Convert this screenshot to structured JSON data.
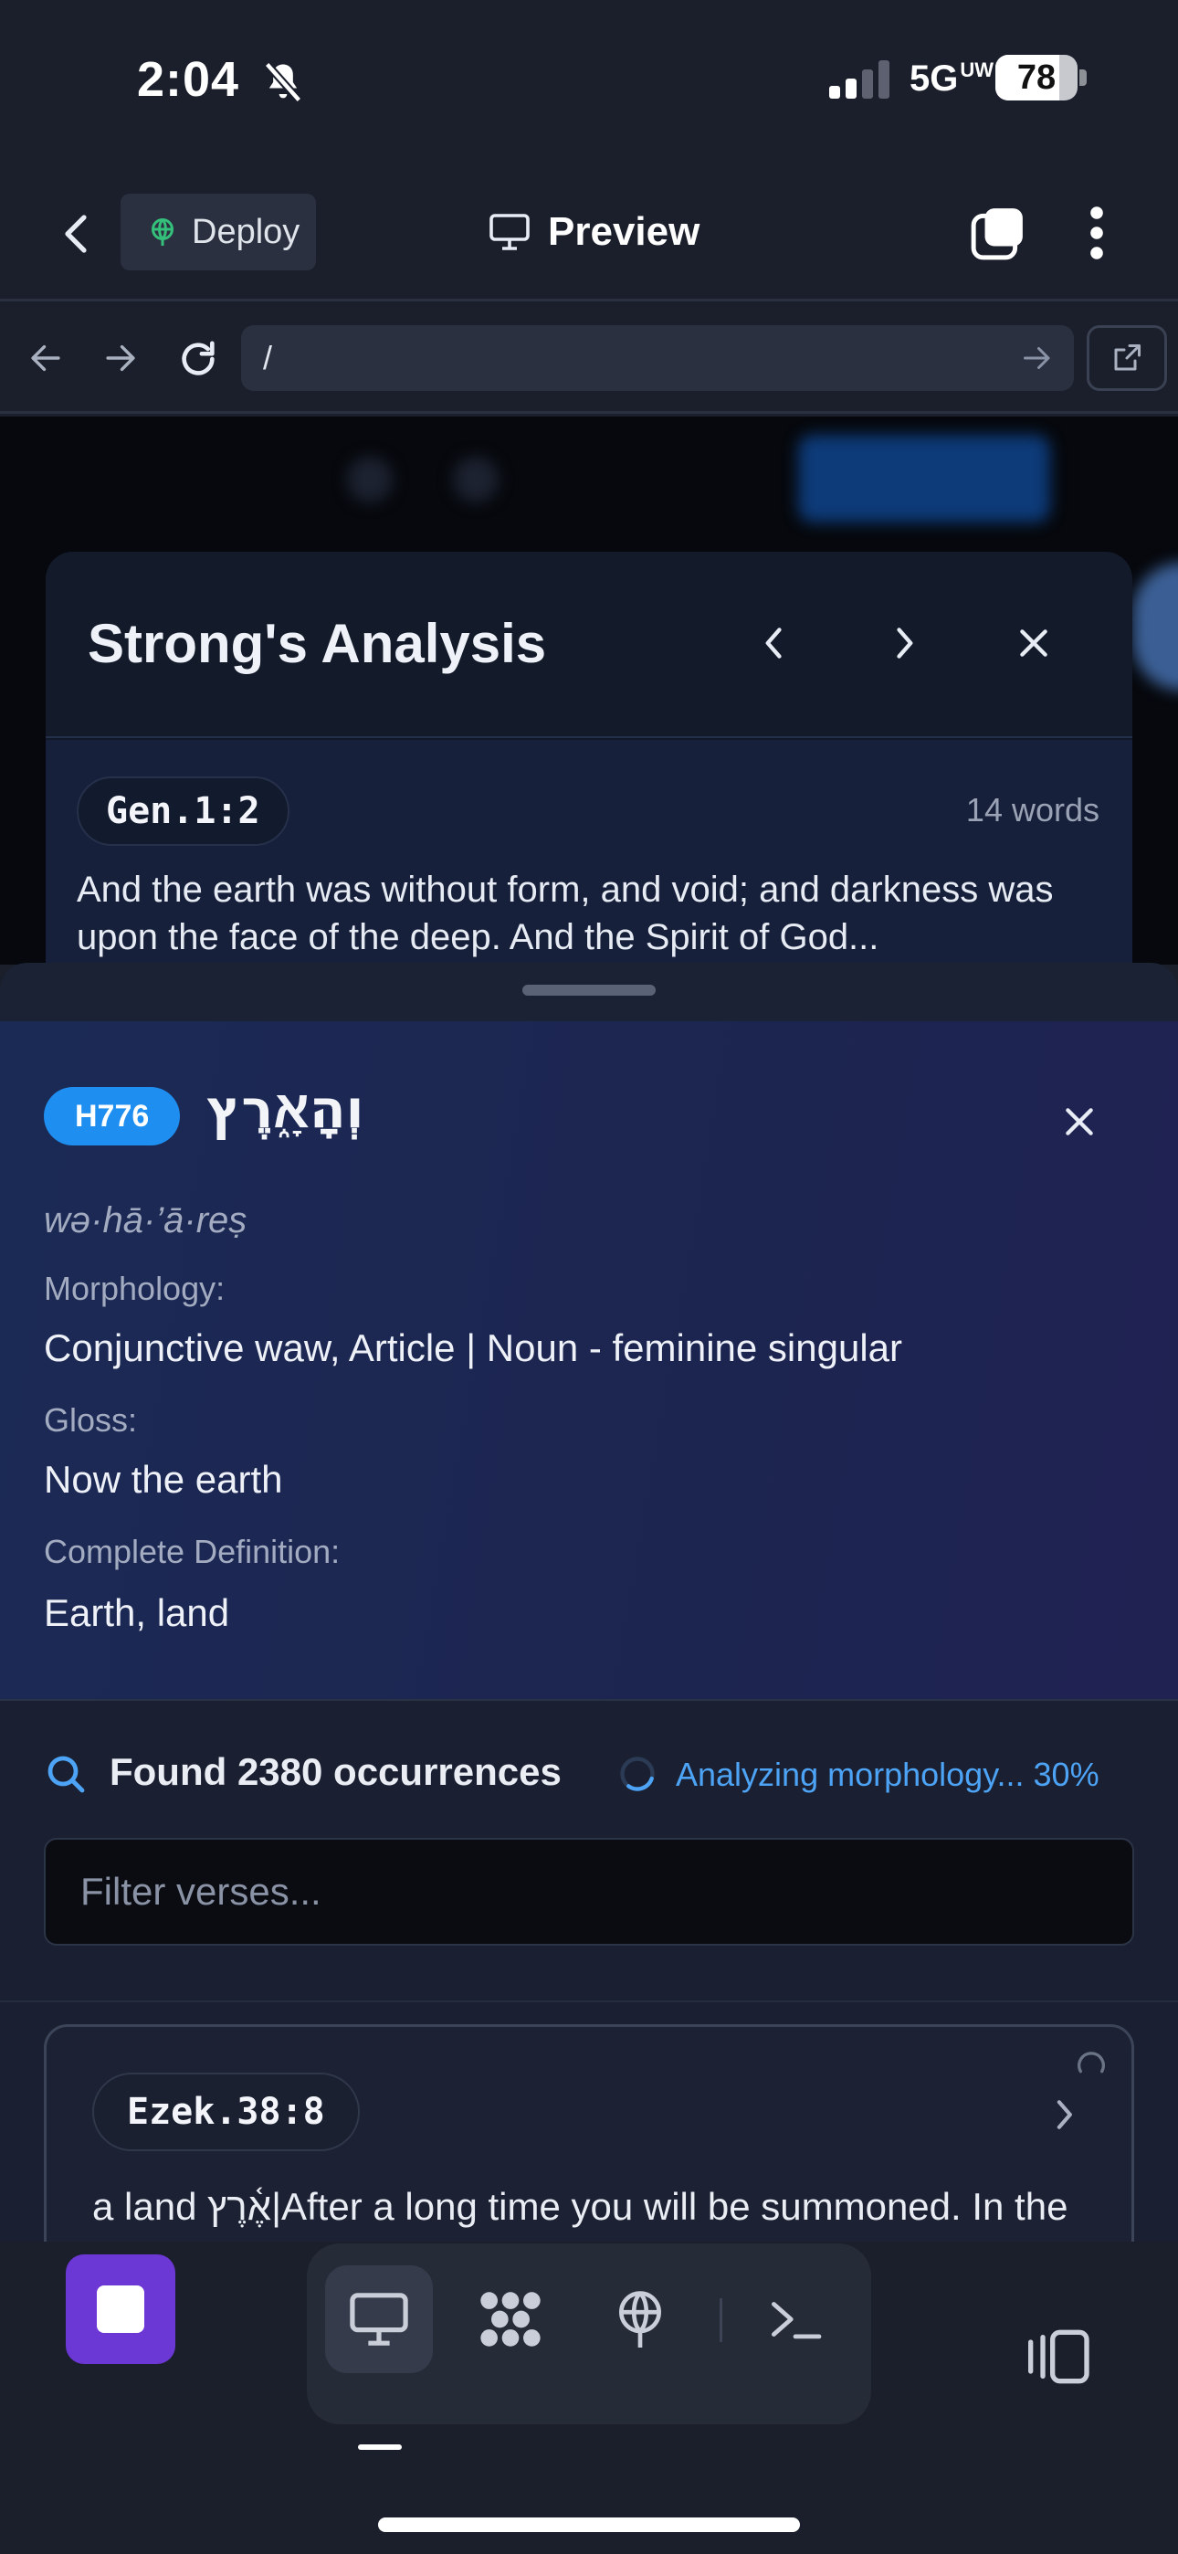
{
  "status_bar": {
    "time": "2:04",
    "network": "5G",
    "network_badge": "UW",
    "battery": "78",
    "battery_level": 0.78
  },
  "header": {
    "deploy_label": "Deploy",
    "preview_label": "Preview"
  },
  "browser": {
    "url": "/"
  },
  "analysis": {
    "title": "Strong's Analysis",
    "verse_ref": "Gen.1:2",
    "word_count": "14 words",
    "verse_text": "And the earth was without form, and void; and darkness was upon the face of the deep. And the Spirit of God..."
  },
  "word": {
    "strong_id": "H776",
    "hebrew": "וְהָאָ֑רֶץ",
    "transliteration": "wə·hā·’ā·reṣ",
    "morphology_label": "Morphology:",
    "morphology": "Conjunctive waw, Article | Noun - feminine singular",
    "gloss_label": "Gloss:",
    "gloss": "Now the earth",
    "definition_label": "Complete Definition:",
    "definition": "Earth, land"
  },
  "occurrences": {
    "count_text": "Found 2380 occurrences",
    "progress_text": "Analyzing morphology... 30%",
    "progress": 0.3,
    "filter_placeholder": "Filter verses...",
    "results": [
      {
        "ref": "Ezek.38:8",
        "text": "a land אֶ֫רֶץ|After a long time you will be summoned. In the latter years you will enter a land that has recovered"
      }
    ]
  },
  "colors": {
    "accent_blue": "#1e8ef0",
    "stop_purple": "#6b38d6",
    "progress_blue": "#4da3f5"
  }
}
